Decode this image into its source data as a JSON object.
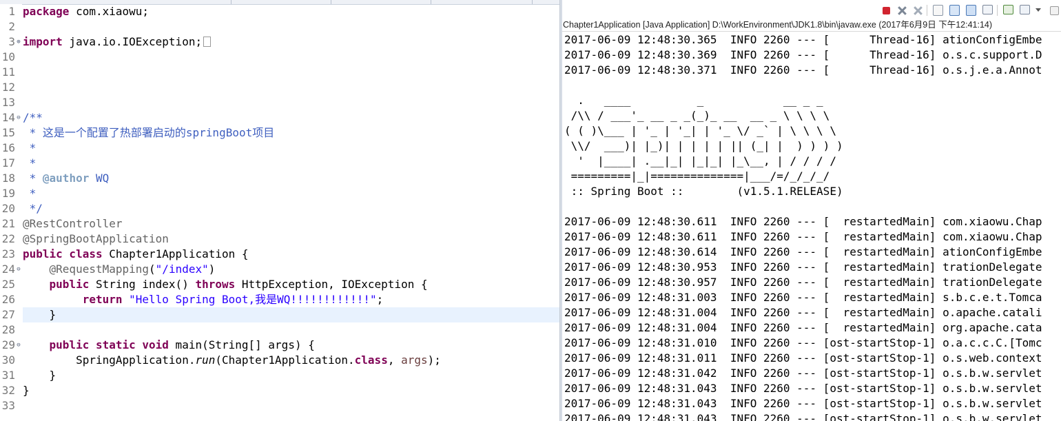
{
  "editor": {
    "line_numbers": [
      "1",
      "2",
      "3",
      "10",
      "11",
      "12",
      "13",
      "14",
      "15",
      "16",
      "17",
      "18",
      "19",
      "20",
      "21",
      "22",
      "23",
      "24",
      "25",
      "26",
      "27",
      "28",
      "29",
      "30",
      "31",
      "32",
      "33"
    ],
    "code": {
      "l1_kw": "package",
      "l1_rest": " com.xiaowu;",
      "l3_kw": "import",
      "l3_rest": " java.io.IOException;",
      "l14": "/**",
      "l15": " * 这是一个配置了热部署启动的springBoot项目",
      "l16": " *",
      "l17": " *",
      "l18_pre": " * ",
      "l18_tag": "@author",
      "l18_rest": " WQ",
      "l19": " *",
      "l20": " */",
      "l21": "@RestController",
      "l22": "@SpringBootApplication",
      "l23_kw": "public class",
      "l23_rest": " Chapter1Application {",
      "l24_ann": "@RequestMapping",
      "l24_open": "(",
      "l24_str": "\"/index\"",
      "l24_close": ")",
      "l25_kw1": "public",
      "l25_mid": " String index() ",
      "l25_kw2": "throws",
      "l25_rest": " HttpException, IOException {",
      "l26_kw": "return",
      "l26_str": "\"Hello Spring Boot,我是WQ!!!!!!!!!!!!\"",
      "l26_end": ";",
      "l27": "}",
      "l29_kw": "public static void",
      "l29_rest": " main(String[] args) {",
      "l30_a": "SpringApplication.",
      "l30_b": "run",
      "l30_c": "(Chapter1Application.",
      "l30_kw": "class",
      "l30_d": ", ",
      "l30_var": "args",
      "l30_e": ");",
      "l31": "}",
      "l32": "}"
    }
  },
  "console": {
    "header": "Chapter1Application [Java Application] D:\\WorkEnvironment\\JDK1.8\\bin\\javaw.exe (2017年6月9日 下午12:41:14)",
    "lines": [
      "2017-06-09 12:48:30.365  INFO 2260 --- [      Thread-16] ationConfigEmbe",
      "2017-06-09 12:48:30.369  INFO 2260 --- [      Thread-16] o.s.c.support.D",
      "2017-06-09 12:48:30.371  INFO 2260 --- [      Thread-16] o.s.j.e.a.Annot",
      "",
      "  .   ____          _            __ _ _",
      " /\\\\ / ___'_ __ _ _(_)_ __  __ _ \\ \\ \\ \\",
      "( ( )\\___ | '_ | '_| | '_ \\/ _` | \\ \\ \\ \\",
      " \\\\/  ___)| |_)| | | | | || (_| |  ) ) ) )",
      "  '  |____| .__|_| |_|_| |_\\__, | / / / /",
      " =========|_|==============|___/=/_/_/_/",
      " :: Spring Boot ::        (v1.5.1.RELEASE)",
      "",
      "2017-06-09 12:48:30.611  INFO 2260 --- [  restartedMain] com.xiaowu.Chap",
      "2017-06-09 12:48:30.611  INFO 2260 --- [  restartedMain] com.xiaowu.Chap",
      "2017-06-09 12:48:30.614  INFO 2260 --- [  restartedMain] ationConfigEmbe",
      "2017-06-09 12:48:30.953  INFO 2260 --- [  restartedMain] trationDelegate",
      "2017-06-09 12:48:30.957  INFO 2260 --- [  restartedMain] trationDelegate",
      "2017-06-09 12:48:31.003  INFO 2260 --- [  restartedMain] s.b.c.e.t.Tomca",
      "2017-06-09 12:48:31.004  INFO 2260 --- [  restartedMain] o.apache.catali",
      "2017-06-09 12:48:31.004  INFO 2260 --- [  restartedMain] org.apache.cata",
      "2017-06-09 12:48:31.010  INFO 2260 --- [ost-startStop-1] o.a.c.c.C.[Tomc",
      "2017-06-09 12:48:31.011  INFO 2260 --- [ost-startStop-1] o.s.web.context",
      "2017-06-09 12:48:31.042  INFO 2260 --- [ost-startStop-1] o.s.b.w.servlet",
      "2017-06-09 12:48:31.043  INFO 2260 --- [ost-startStop-1] o.s.b.w.servlet",
      "2017-06-09 12:48:31.043  INFO 2260 --- [ost-startStop-1] o.s.b.w.servlet",
      "2017-06-09 12:48:31.043  INFO 2260 --- [ost-startStop-1] o.s.b.w.servlet"
    ]
  }
}
